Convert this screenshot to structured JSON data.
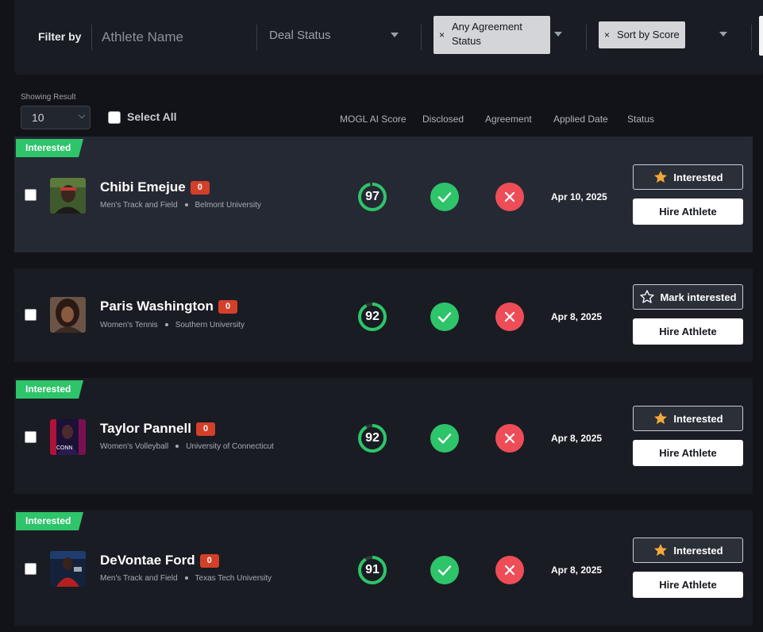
{
  "filters": {
    "label": "Filter by",
    "athlete_placeholder": "Athlete Name",
    "deal_status": "Deal Status",
    "agreement_chip": "Any Agreement Status",
    "sort_chip": "Sort by Score",
    "chip_remove_glyph": "×"
  },
  "controls": {
    "showing_label": "Showing Result",
    "page_size": "10",
    "select_all": "Select All"
  },
  "columns": [
    "MOGL AI Score",
    "Disclosed",
    "Agreement",
    "Applied Date",
    "Status"
  ],
  "colors": {
    "accent_green": "#2ec46a",
    "reject_red": "#ee4d58",
    "count_badge": "#d43f2a",
    "star": "#f3a83b"
  },
  "rows": [
    {
      "tag": "Interested",
      "name": "Chibi Emejue",
      "deal_count": "0",
      "sport": "Men's Track and Field",
      "school": "Belmont University",
      "score": "97",
      "score_value": 97,
      "date": "Apr 10, 2025",
      "interest_label": "Interested",
      "interested": true,
      "hire_label": "Hire Athlete"
    },
    {
      "tag": "",
      "name": "Paris Washington",
      "deal_count": "0",
      "sport": "Women's Tennis",
      "school": "Southern University",
      "score": "92",
      "score_value": 92,
      "date": "Apr 8, 2025",
      "interest_label": "Mark interested",
      "interested": false,
      "hire_label": "Hire Athlete"
    },
    {
      "tag": "Interested",
      "name": "Taylor Pannell",
      "deal_count": "0",
      "sport": "Women's Volleyball",
      "school": "University of Connecticut",
      "score": "92",
      "score_value": 92,
      "date": "Apr 8, 2025",
      "interest_label": "Interested",
      "interested": true,
      "hire_label": "Hire Athlete"
    },
    {
      "tag": "Interested",
      "name": "DeVontae Ford",
      "deal_count": "0",
      "sport": "Men's Track and Field",
      "school": "Texas Tech University",
      "score": "91",
      "score_value": 91,
      "date": "Apr 8, 2025",
      "interest_label": "Interested",
      "interested": true,
      "hire_label": "Hire Athlete"
    }
  ]
}
